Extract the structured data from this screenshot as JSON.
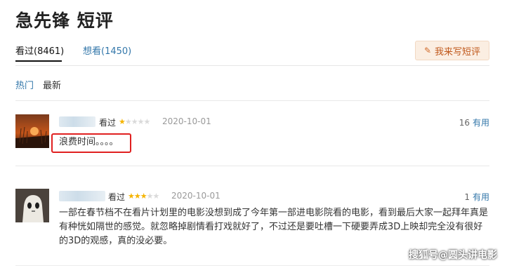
{
  "page": {
    "title": "急先锋 短评"
  },
  "tabs": {
    "seen": "看过(8461)",
    "want": "想看(1450)"
  },
  "write_button": {
    "label": "我来写短评",
    "icon": "pencil-icon"
  },
  "sort": {
    "hot": "热门",
    "new": "最新"
  },
  "reviews": [
    {
      "status": "看过",
      "stars": 1,
      "date": "2020-10-01",
      "votes": "16",
      "useful_label": "有用",
      "text": "浪费时间。。。。"
    },
    {
      "status": "看过",
      "stars": 3,
      "date": "2020-10-01",
      "votes": "1",
      "useful_label": "有用",
      "text": "一部在春节档不在看片计划里的电影没想到成了今年第一部进电影院看的电影，看到最后大家一起拜年真是有种恍如隔世的感觉。就忽略掉剧情看打戏就好了，不过还是要吐槽一下硬要弄成3D上映却完全没有很好的3D的观感，真的没必要。"
    }
  ],
  "watermark": "搜狐号@圆头讲电影",
  "colors": {
    "link": "#3377aa",
    "star": "#f5b400",
    "highlight": "#e02020",
    "button_bg": "#fbeee2",
    "button_text": "#c0581b"
  }
}
